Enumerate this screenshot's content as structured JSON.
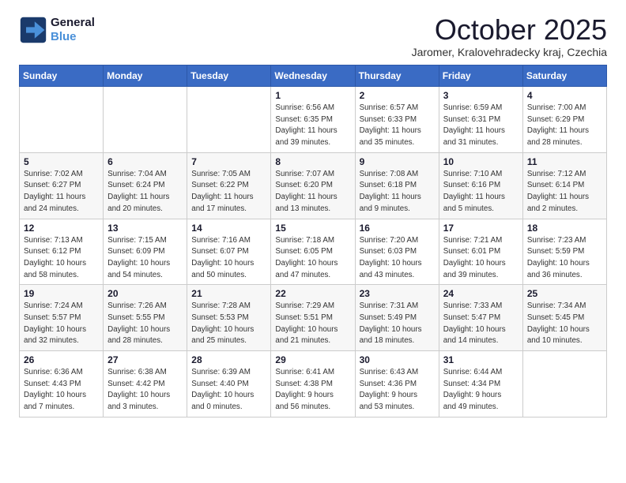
{
  "logo": {
    "line1": "General",
    "line2": "Blue"
  },
  "title": "October 2025",
  "subtitle": "Jaromer, Kralovehradecky kraj, Czechia",
  "days_of_week": [
    "Sunday",
    "Monday",
    "Tuesday",
    "Wednesday",
    "Thursday",
    "Friday",
    "Saturday"
  ],
  "weeks": [
    [
      {
        "day": "",
        "info": ""
      },
      {
        "day": "",
        "info": ""
      },
      {
        "day": "",
        "info": ""
      },
      {
        "day": "1",
        "info": "Sunrise: 6:56 AM\nSunset: 6:35 PM\nDaylight: 11 hours\nand 39 minutes."
      },
      {
        "day": "2",
        "info": "Sunrise: 6:57 AM\nSunset: 6:33 PM\nDaylight: 11 hours\nand 35 minutes."
      },
      {
        "day": "3",
        "info": "Sunrise: 6:59 AM\nSunset: 6:31 PM\nDaylight: 11 hours\nand 31 minutes."
      },
      {
        "day": "4",
        "info": "Sunrise: 7:00 AM\nSunset: 6:29 PM\nDaylight: 11 hours\nand 28 minutes."
      }
    ],
    [
      {
        "day": "5",
        "info": "Sunrise: 7:02 AM\nSunset: 6:27 PM\nDaylight: 11 hours\nand 24 minutes."
      },
      {
        "day": "6",
        "info": "Sunrise: 7:04 AM\nSunset: 6:24 PM\nDaylight: 11 hours\nand 20 minutes."
      },
      {
        "day": "7",
        "info": "Sunrise: 7:05 AM\nSunset: 6:22 PM\nDaylight: 11 hours\nand 17 minutes."
      },
      {
        "day": "8",
        "info": "Sunrise: 7:07 AM\nSunset: 6:20 PM\nDaylight: 11 hours\nand 13 minutes."
      },
      {
        "day": "9",
        "info": "Sunrise: 7:08 AM\nSunset: 6:18 PM\nDaylight: 11 hours\nand 9 minutes."
      },
      {
        "day": "10",
        "info": "Sunrise: 7:10 AM\nSunset: 6:16 PM\nDaylight: 11 hours\nand 5 minutes."
      },
      {
        "day": "11",
        "info": "Sunrise: 7:12 AM\nSunset: 6:14 PM\nDaylight: 11 hours\nand 2 minutes."
      }
    ],
    [
      {
        "day": "12",
        "info": "Sunrise: 7:13 AM\nSunset: 6:12 PM\nDaylight: 10 hours\nand 58 minutes."
      },
      {
        "day": "13",
        "info": "Sunrise: 7:15 AM\nSunset: 6:09 PM\nDaylight: 10 hours\nand 54 minutes."
      },
      {
        "day": "14",
        "info": "Sunrise: 7:16 AM\nSunset: 6:07 PM\nDaylight: 10 hours\nand 50 minutes."
      },
      {
        "day": "15",
        "info": "Sunrise: 7:18 AM\nSunset: 6:05 PM\nDaylight: 10 hours\nand 47 minutes."
      },
      {
        "day": "16",
        "info": "Sunrise: 7:20 AM\nSunset: 6:03 PM\nDaylight: 10 hours\nand 43 minutes."
      },
      {
        "day": "17",
        "info": "Sunrise: 7:21 AM\nSunset: 6:01 PM\nDaylight: 10 hours\nand 39 minutes."
      },
      {
        "day": "18",
        "info": "Sunrise: 7:23 AM\nSunset: 5:59 PM\nDaylight: 10 hours\nand 36 minutes."
      }
    ],
    [
      {
        "day": "19",
        "info": "Sunrise: 7:24 AM\nSunset: 5:57 PM\nDaylight: 10 hours\nand 32 minutes."
      },
      {
        "day": "20",
        "info": "Sunrise: 7:26 AM\nSunset: 5:55 PM\nDaylight: 10 hours\nand 28 minutes."
      },
      {
        "day": "21",
        "info": "Sunrise: 7:28 AM\nSunset: 5:53 PM\nDaylight: 10 hours\nand 25 minutes."
      },
      {
        "day": "22",
        "info": "Sunrise: 7:29 AM\nSunset: 5:51 PM\nDaylight: 10 hours\nand 21 minutes."
      },
      {
        "day": "23",
        "info": "Sunrise: 7:31 AM\nSunset: 5:49 PM\nDaylight: 10 hours\nand 18 minutes."
      },
      {
        "day": "24",
        "info": "Sunrise: 7:33 AM\nSunset: 5:47 PM\nDaylight: 10 hours\nand 14 minutes."
      },
      {
        "day": "25",
        "info": "Sunrise: 7:34 AM\nSunset: 5:45 PM\nDaylight: 10 hours\nand 10 minutes."
      }
    ],
    [
      {
        "day": "26",
        "info": "Sunrise: 6:36 AM\nSunset: 4:43 PM\nDaylight: 10 hours\nand 7 minutes."
      },
      {
        "day": "27",
        "info": "Sunrise: 6:38 AM\nSunset: 4:42 PM\nDaylight: 10 hours\nand 3 minutes."
      },
      {
        "day": "28",
        "info": "Sunrise: 6:39 AM\nSunset: 4:40 PM\nDaylight: 10 hours\nand 0 minutes."
      },
      {
        "day": "29",
        "info": "Sunrise: 6:41 AM\nSunset: 4:38 PM\nDaylight: 9 hours\nand 56 minutes."
      },
      {
        "day": "30",
        "info": "Sunrise: 6:43 AM\nSunset: 4:36 PM\nDaylight: 9 hours\nand 53 minutes."
      },
      {
        "day": "31",
        "info": "Sunrise: 6:44 AM\nSunset: 4:34 PM\nDaylight: 9 hours\nand 49 minutes."
      },
      {
        "day": "",
        "info": ""
      }
    ]
  ]
}
